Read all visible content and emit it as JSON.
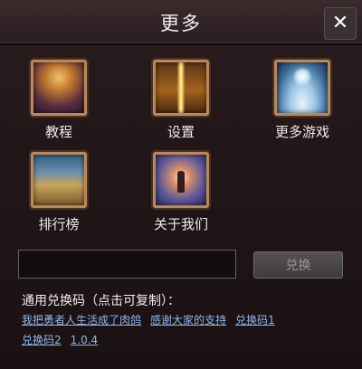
{
  "header": {
    "title": "更多",
    "close_icon": "close-icon"
  },
  "menu": {
    "items": [
      {
        "label": "教程",
        "icon": "tutorial-icon"
      },
      {
        "label": "设置",
        "icon": "settings-icon"
      },
      {
        "label": "更多游戏",
        "icon": "more-games-icon"
      },
      {
        "label": "排行榜",
        "icon": "leaderboard-icon"
      },
      {
        "label": "关于我们",
        "icon": "about-us-icon"
      }
    ]
  },
  "redeem": {
    "input_value": "",
    "input_placeholder": "",
    "button_label": "兑换"
  },
  "codes": {
    "title": "通用兑换码（点击可复制）：",
    "items": [
      "我把勇者人生活成了肉鸽",
      "感谢大家的支持",
      "兑换码1",
      "兑换码2",
      "1.0.4"
    ]
  },
  "colors": {
    "background": "#221718",
    "link": "#8fb6ea",
    "icon_border": "#b9895c"
  }
}
